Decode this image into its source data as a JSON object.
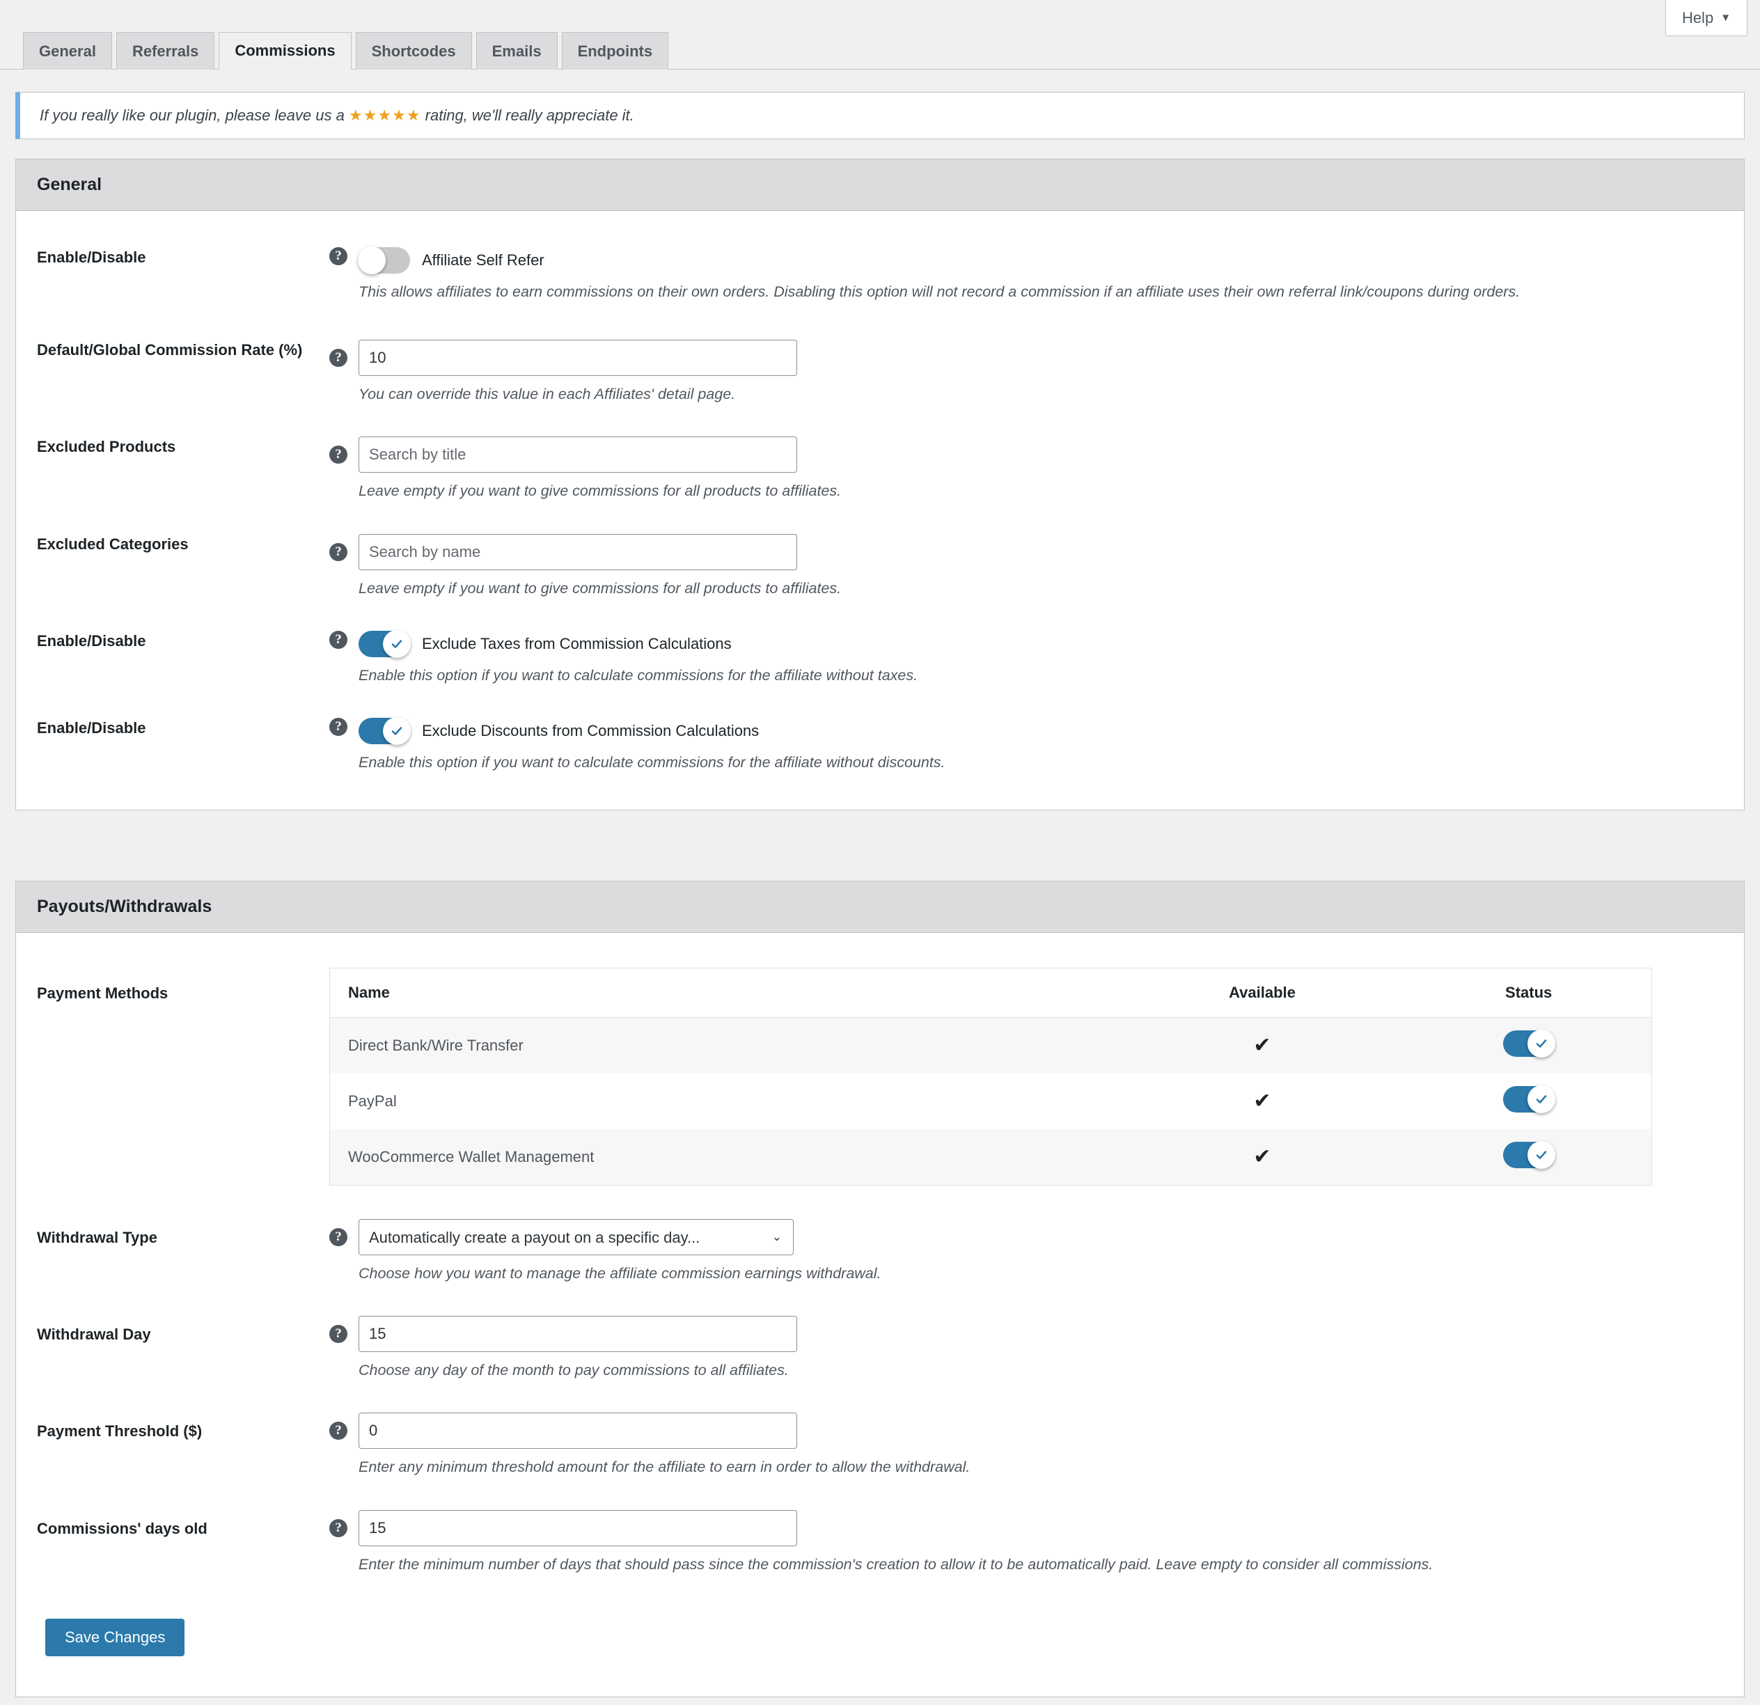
{
  "header": {
    "help_label": "Help",
    "help_caret": "▼"
  },
  "tabs": [
    {
      "label": "General",
      "active": false
    },
    {
      "label": "Referrals",
      "active": false
    },
    {
      "label": "Commissions",
      "active": true
    },
    {
      "label": "Shortcodes",
      "active": false
    },
    {
      "label": "Emails",
      "active": false
    },
    {
      "label": "Endpoints",
      "active": false
    }
  ],
  "notice": {
    "text_before": "If you really like our plugin, please leave us a ",
    "stars": "★★★★★",
    "text_after": " rating, we'll really appreciate it."
  },
  "general": {
    "title": "General",
    "self_refer": {
      "label": "Enable/Disable",
      "toggle_label": "Affiliate Self Refer",
      "state": "off",
      "description": "This allows affiliates to earn commissions on their own orders. Disabling this option will not record a commission if an affiliate uses their own referral link/coupons during orders."
    },
    "commission_rate": {
      "label": "Default/Global Commission Rate (%)",
      "value": "10",
      "description": "You can override this value in each Affiliates' detail page."
    },
    "excluded_products": {
      "label": "Excluded Products",
      "value": "",
      "placeholder": "Search by title",
      "description": "Leave empty if you want to give commissions for all products to affiliates."
    },
    "excluded_categories": {
      "label": "Excluded Categories",
      "value": "",
      "placeholder": "Search by name",
      "description": "Leave empty if you want to give commissions for all products to affiliates."
    },
    "exclude_taxes": {
      "label": "Enable/Disable",
      "toggle_label": "Exclude Taxes from Commission Calculations",
      "state": "on",
      "description": "Enable this option if you want to calculate commissions for the affiliate without taxes."
    },
    "exclude_discounts": {
      "label": "Enable/Disable",
      "toggle_label": "Exclude Discounts from Commission Calculations",
      "state": "on",
      "description": "Enable this option if you want to calculate commissions for the affiliate without discounts."
    }
  },
  "payouts": {
    "title": "Payouts/Withdrawals",
    "payment_methods": {
      "label": "Payment Methods",
      "columns": [
        "Name",
        "Available",
        "Status"
      ],
      "rows": [
        {
          "name": "Direct Bank/Wire Transfer",
          "available": "✔",
          "status": "on"
        },
        {
          "name": "PayPal",
          "available": "✔",
          "status": "on"
        },
        {
          "name": "WooCommerce Wallet Management",
          "available": "✔",
          "status": "on"
        }
      ]
    },
    "withdrawal_type": {
      "label": "Withdrawal Type",
      "value": "Automatically create a payout on a specific day...",
      "caret": "⌄",
      "description": "Choose how you want to manage the affiliate commission earnings withdrawal."
    },
    "withdrawal_day": {
      "label": "Withdrawal Day",
      "value": "15",
      "description": "Choose any day of the month to pay commissions to all affiliates."
    },
    "payment_threshold": {
      "label": "Payment Threshold ($)",
      "value": "0",
      "description": "Enter any minimum threshold amount for the affiliate to earn in order to allow the withdrawal."
    },
    "commissions_days_old": {
      "label": "Commissions' days old",
      "value": "15",
      "description": "Enter the minimum number of days that should pass since the commission's creation to allow it to be automatically paid. Leave empty to consider all commissions."
    },
    "save_label": "Save Changes"
  },
  "icons": {
    "help_tip": "?"
  },
  "colors": {
    "accent": "#2b7aab",
    "star": "#f0a01e",
    "notice_border": "#72aee6",
    "panel_head": "#dcdcde"
  }
}
